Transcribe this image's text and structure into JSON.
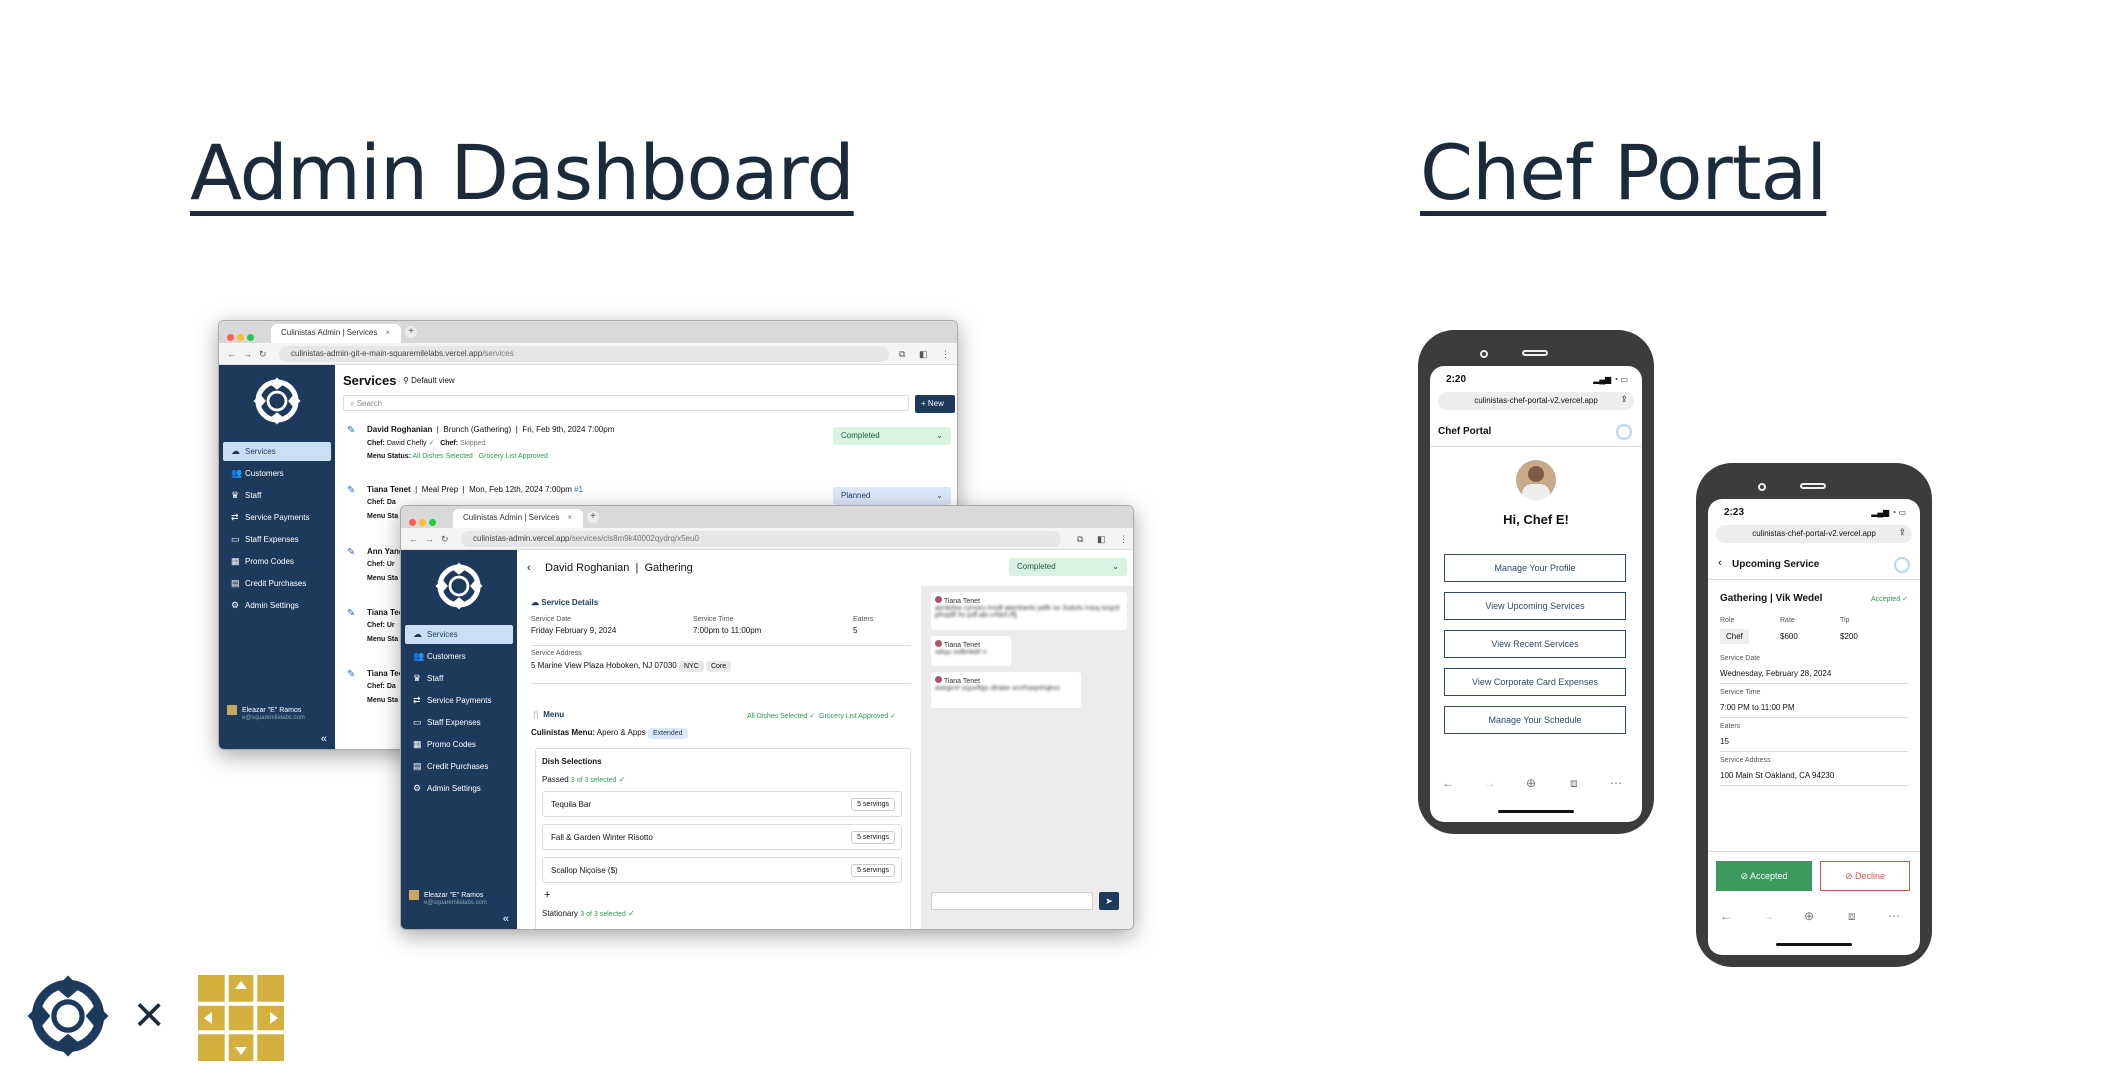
{
  "headings": {
    "admin": "Admin Dashboard",
    "chef": "Chef Portal"
  },
  "colors": {
    "navy": "#1d3a5c",
    "heading": "#1c2b3c",
    "green": "#2e9b4f",
    "gold": "#d4b03f",
    "decline": "#d9534f"
  },
  "admin_back": {
    "tab_title": "Culinistas Admin | Services",
    "url_host": "culinistas-admin-git-e-main-squaremilelabs.vercel.app",
    "url_path": "/services",
    "page_title": "Services",
    "view_label": "Default view",
    "search_placeholder": "Search",
    "new_button": "+ New",
    "sidebar": [
      "Services",
      "Customers",
      "Staff",
      "Service Payments",
      "Staff Expenses",
      "Promo Codes",
      "Credit Purchases",
      "Admin Settings"
    ],
    "user_name": "Eleazar \"E\" Ramos",
    "user_email": "e@squaremilelabs.com",
    "rows": [
      {
        "name": "David Roghanian",
        "type": "Brunch (Gathering)",
        "date": "Fri, Feb 9th, 2024 7:00pm",
        "chef_label": "Chef:",
        "chef": "David Chefly",
        "chef2_label": "Chef:",
        "chef2": "Skipped",
        "menu_label": "Menu Status:",
        "menu1": "All Dishes Selected",
        "menu2": "Grocery List Approved",
        "status": "Completed"
      },
      {
        "name": "Tiana Tenet",
        "type": "Meal Prep",
        "date": "Mon, Feb 12th, 2024 7:00pm",
        "extra": "#1",
        "chef_label": "Chef: Da",
        "menu_label": "Menu Sta",
        "status": "Planned"
      },
      {
        "name": "Ann Yang",
        "chef_label": "Chef: Ur",
        "menu_label": "Menu Sta"
      },
      {
        "name": "Tiana Tee",
        "chef_label": "Chef: Ur",
        "menu_label": "Menu Sta"
      },
      {
        "name": "Tiana Tee",
        "chef_label": "Chef: Da",
        "menu_label": "Menu Sta"
      }
    ]
  },
  "admin_front": {
    "tab_title": "Culinistas Admin | Services",
    "url_host": "culinistas-admin.vercel.app",
    "url_path": "/services/cls8m9k40002qydrq/x5eu0",
    "customer": "David Roghanian",
    "service_type": "Gathering",
    "status": "Completed",
    "details_title": "Service Details",
    "service_date_label": "Service Date",
    "service_date": "Friday February 9, 2024",
    "service_time_label": "Service Time",
    "service_time": "7:00pm to 11:00pm",
    "eaters_label": "Eaters",
    "eaters": "5",
    "address_label": "Service Address",
    "address": "5 Marine View Plaza Hoboken, NJ 07030",
    "tag1": "NYC",
    "tag2": "Core",
    "menu_title": "Menu",
    "menu_status1": "All Dishes Selected",
    "menu_status2": "Grocery List Approved",
    "menu_name_label": "Culinistas Menu:",
    "menu_name": "Apero & Apps",
    "menu_tag": "Extended",
    "dish_selections": "Dish Selections",
    "passed_label": "Passed",
    "passed_count": "3 of 3 selected",
    "dishes": [
      {
        "name": "Tequila Bar",
        "servings": "5 servings"
      },
      {
        "name": "Fall & Garden Winter Risotto",
        "servings": "5 servings"
      },
      {
        "name": "Scallop Niçoise ($)",
        "servings": "5 servings"
      }
    ],
    "add": "+",
    "stationary_label": "Stationary",
    "stationary_count": "3 of 3 selected",
    "sidebar": [
      "Services",
      "Customers",
      "Staff",
      "Service Payments",
      "Staff Expenses",
      "Promo Codes",
      "Credit Purchases",
      "Admin Settings"
    ],
    "user_name": "Eleazar \"E\" Ramos",
    "user_email": "e@squaremilelabs.com",
    "messages": [
      {
        "author": "Tiana Tenet",
        "text": "aenbrbsi cynsiru lnsdf aberbarits pdfk so 3sdufs /rasij lsnjzd pfnqdfl hs pdf.aki.crfdcf.rffj"
      },
      {
        "author": "Tiana Tenet",
        "text": "sdsju isdbnkdif n"
      },
      {
        "author": "Tiana Tenet",
        "text": "asegcnf ssjuvfbju dlrabe srn/hsejnhsjkss"
      }
    ]
  },
  "phone1": {
    "time": "2:20",
    "url": "culinistas-chef-portal-v2.vercel.app",
    "header": "Chef Portal",
    "greeting": "Hi, Chef E!",
    "buttons": [
      "Manage Your Profile",
      "View Upcoming Services",
      "View Recent Services",
      "View Corporate Card Expenses",
      "Manage Your Schedule"
    ]
  },
  "phone2": {
    "time": "2:23",
    "url": "culinistas-chef-portal-v2.vercel.app",
    "header": "Upcoming Service",
    "title": "Gathering | Vik Wedel",
    "status": "Accepted",
    "role_label": "Role",
    "role": "Chef",
    "rate_label": "Rate",
    "rate": "$600",
    "tip_label": "Tip",
    "tip": "$200",
    "date_label": "Service Date",
    "date": "Wednesday, February 28, 2024",
    "time_label": "Service Time",
    "service_time": "7:00 PM to 11:00 PM",
    "eaters_label": "Eaters",
    "eaters": "15",
    "address_label": "Service Address",
    "address": "100 Main St Oakland, CA 94230",
    "accept_btn": "Accepted",
    "decline_btn": "Decline"
  },
  "footer": {
    "times": "×"
  }
}
